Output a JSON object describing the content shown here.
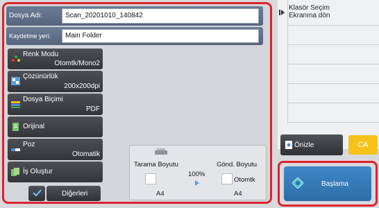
{
  "fields": {
    "file_name_label": "Dosya Adı:",
    "file_name_value": "Scan_20201010_140842",
    "save_location_label": "Kaydetme yeri:",
    "save_location_value": "Main Folder"
  },
  "menu": [
    {
      "label": "Renk Modu",
      "value": "Otomtk/Mono2",
      "icon": "color-mode-icon"
    },
    {
      "label": "Çözünürlük",
      "value": "200x200dpi",
      "icon": "resolution-icon"
    },
    {
      "label": "Dosya Biçimi",
      "value": "PDF",
      "icon": "file-format-icon"
    },
    {
      "label": "Orijinal",
      "value": "",
      "icon": "original-icon"
    },
    {
      "label": "Poz",
      "value": "Otomatik",
      "icon": "exposure-icon"
    },
    {
      "label": "İş Oluştur",
      "value": "",
      "icon": "job-build-icon"
    }
  ],
  "others_label": "Diğerleri",
  "preview": {
    "scan_size_label": "Tarama Boyutu",
    "send_size_label": "Gönd. Boyutu",
    "ratio": "100%",
    "scan_size": "A4",
    "send_mode": "Otomtk",
    "send_size": "A4"
  },
  "right": {
    "folder_select": "Klasör Seçim Ekranına dön",
    "preview_button": "Önizle",
    "ca_button": "CA",
    "start_button": "Başlama"
  },
  "colors": {
    "highlight": "#e0212b",
    "start": "#2f75b5",
    "ca": "#f6c21a"
  }
}
